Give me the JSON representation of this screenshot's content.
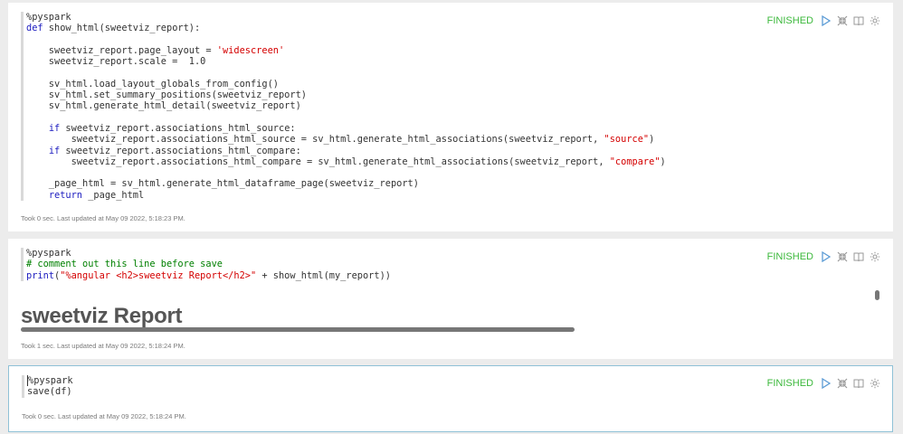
{
  "paragraphs": [
    {
      "status": "FINISHED",
      "code": {
        "l1": "%pyspark",
        "l2_kw": "def",
        "l2_rest": " show_html(sweetviz_report):",
        "l4_a": "    sweetviz_report.page_layout = ",
        "l4_str": "'widescreen'",
        "l5": "    sweetviz_report.scale =  1.0",
        "l7": "    sv_html.load_layout_globals_from_config()",
        "l8": "    sv_html.set_summary_positions(sweetviz_report)",
        "l9": "    sv_html.generate_html_detail(sweetviz_report)",
        "l11_indent": "    ",
        "l11_kw": "if",
        "l11_rest": " sweetviz_report.associations_html_source:",
        "l12_a": "        sweetviz_report.associations_html_source = sv_html.generate_html_associations(sweetviz_report, ",
        "l12_str": "\"source\"",
        "l12_b": ")",
        "l13_indent": "    ",
        "l13_kw": "if",
        "l13_rest": " sweetviz_report.associations_html_compare:",
        "l14_a": "        sweetviz_report.associations_html_compare = sv_html.generate_html_associations(sweetviz_report, ",
        "l14_str": "\"compare\"",
        "l14_b": ")",
        "l16": "    _page_html = sv_html.generate_html_dataframe_page(sweetviz_report)",
        "l17_indent": "    ",
        "l17_kw": "return",
        "l17_rest": " _page_html"
      },
      "footer": "Took 0 sec. Last updated at May 09 2022, 5:18:23 PM."
    },
    {
      "status": "FINISHED",
      "code": {
        "l1": "%pyspark",
        "l2": "# comment out this line before save",
        "l3_kw": "print",
        "l3_a": "(",
        "l3_str": "\"%angular <h2>sweetviz Report</h2>\"",
        "l3_b": " + show_html(my_report))"
      },
      "output_title": "sweetviz Report",
      "footer": "Took 1 sec. Last updated at May 09 2022, 5:18:24 PM."
    },
    {
      "status": "FINISHED",
      "code": {
        "l1": "%pyspark",
        "l2": "save(df)"
      },
      "footer": "Took 0 sec. Last updated at May 09 2022, 5:18:24 PM."
    }
  ],
  "icons": [
    "run-icon",
    "collapse-icon",
    "book-icon",
    "gear-icon"
  ],
  "colors": {
    "finished": "#3bb83b",
    "keyword": "#1c1cbf",
    "string": "#d40000",
    "comment": "#008000",
    "icon": "#5b9bd5"
  }
}
